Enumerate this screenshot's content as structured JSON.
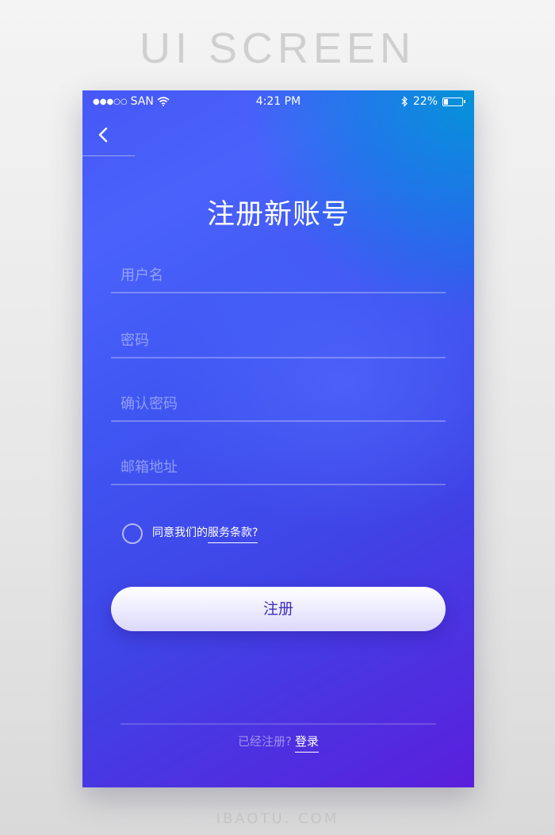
{
  "banner": "UI SCREEN",
  "footer_brand": "IBAOTU. COM",
  "status_bar": {
    "carrier": "SAN",
    "time": "4:21 PM",
    "battery_text": "22%",
    "battery_level": 0.22
  },
  "title": "注册新账号",
  "fields": {
    "username_placeholder": "用户名",
    "password_placeholder": "密码",
    "confirm_placeholder": "确认密码",
    "email_placeholder": "邮箱地址"
  },
  "agreement": {
    "prefix": "同意我们的",
    "terms": "服务条款?"
  },
  "register_button": "注册",
  "footer": {
    "already": "已经注册?",
    "login": "登录"
  }
}
